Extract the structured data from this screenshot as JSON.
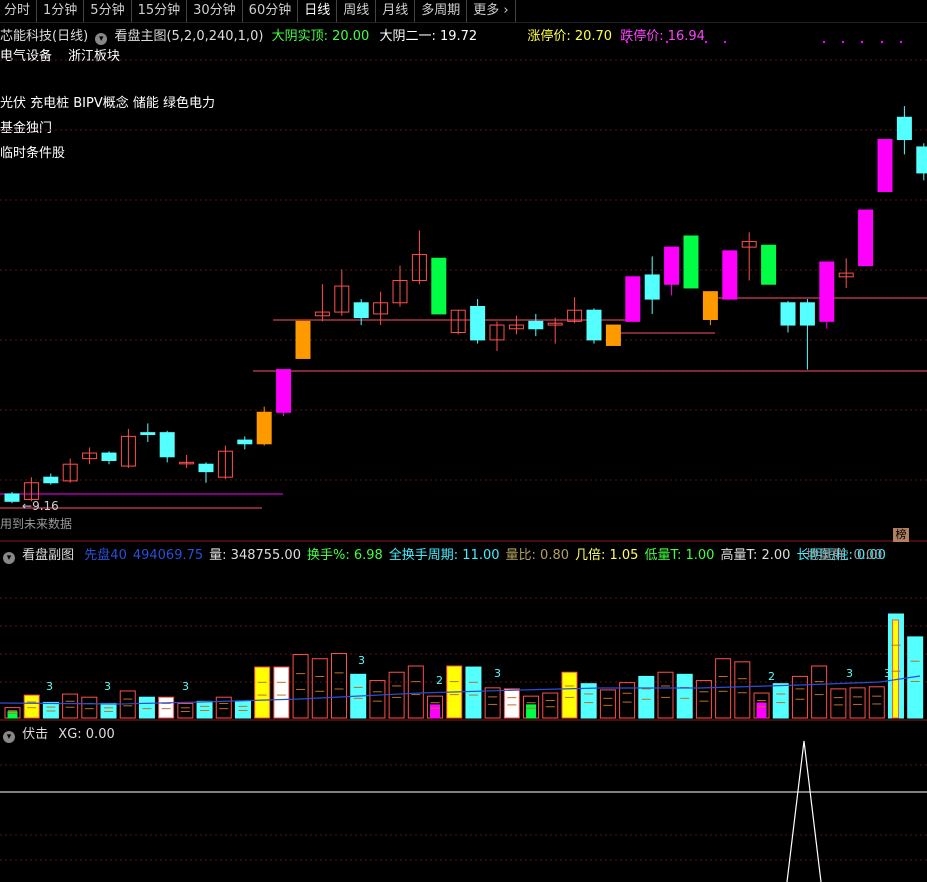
{
  "tabs": [
    "分时",
    "1分钟",
    "5分钟",
    "15分钟",
    "30分钟",
    "60分钟",
    "日线",
    "周线",
    "月线",
    "多周期",
    "更多"
  ],
  "active_tab": "日线",
  "main": {
    "stock": "芯能科技(日线)",
    "indicator": "看盘主图(5,2,0,240,1,0)",
    "yinshi_label": "大阴实顶: 20.00",
    "dayin_label": "大阴二一: 19.72",
    "limit_up": "涨停价: 20.70",
    "limit_down": "跌停价: 16.94",
    "sector1": "电气设备",
    "sector2": "浙江板块",
    "concepts": "光伏 充电桩 BIPV概念 储能 绿色电力",
    "fund": "基金独门",
    "temp": "临时条件股",
    "low_price": "9.16",
    "future_data": "用到未来数据",
    "bang_badge": "榜"
  },
  "sub": {
    "title": "看盘副图",
    "items": [
      {
        "t": "先盘40",
        "c": "#2a4fd6"
      },
      {
        "t": "494069.75",
        "c": "#2a4fd6"
      },
      {
        "t": "量: 348755.00",
        "c": "#dddddd"
      },
      {
        "t": "换手%: 6.98",
        "c": "#44ff44"
      },
      {
        "t": "全换手周期: 11.00",
        "c": "#44eeff"
      },
      {
        "t": "量比: 0.80",
        "c": "#b0a060"
      },
      {
        "t": "几倍: 1.05",
        "c": "#ffff66"
      },
      {
        "t": "低量T: 1.00",
        "c": "#44ff44"
      },
      {
        "t": "高量T: 2.00",
        "c": "#dddddd"
      },
      {
        "t": "长阴短柱: 0.00",
        "c": "#44eeff"
      }
    ],
    "diliang": "地量群: 0.00",
    "vol_tags": [
      "3",
      "3",
      "3",
      "3",
      "2",
      "3",
      "2",
      "3",
      "3"
    ]
  },
  "fuji": {
    "title": "伏击",
    "xg": "XG: 0.00"
  },
  "colors": {
    "up": "#ff4f4f",
    "down": "#54ffff",
    "magenta": "#ff00ff",
    "green": "#00ff44",
    "orange": "#ff9900",
    "grid": "#5a1414"
  },
  "candles": [
    {
      "o": 9.25,
      "c": 9.05,
      "h": 9.3,
      "l": 9.0,
      "k": "down"
    },
    {
      "o": 9.1,
      "c": 9.55,
      "h": 9.7,
      "l": 9.05,
      "k": "up"
    },
    {
      "o": 9.7,
      "c": 9.55,
      "h": 9.8,
      "l": 9.5,
      "k": "down"
    },
    {
      "o": 9.6,
      "c": 10.05,
      "h": 10.2,
      "l": 9.55,
      "k": "up"
    },
    {
      "o": 10.2,
      "c": 10.35,
      "h": 10.5,
      "l": 10.05,
      "k": "up"
    },
    {
      "o": 10.35,
      "c": 10.15,
      "h": 10.4,
      "l": 10.05,
      "k": "down"
    },
    {
      "o": 10.0,
      "c": 10.8,
      "h": 11.0,
      "l": 9.95,
      "k": "up"
    },
    {
      "o": 10.85,
      "c": 10.9,
      "h": 11.15,
      "l": 10.65,
      "k": "down"
    },
    {
      "o": 10.9,
      "c": 10.25,
      "h": 10.95,
      "l": 10.1,
      "k": "down"
    },
    {
      "o": 10.1,
      "c": 10.1,
      "h": 10.3,
      "l": 9.95,
      "k": "up"
    },
    {
      "o": 10.05,
      "c": 9.85,
      "h": 10.1,
      "l": 9.55,
      "k": "down"
    },
    {
      "o": 9.7,
      "c": 10.4,
      "h": 10.55,
      "l": 9.65,
      "k": "up"
    },
    {
      "o": 10.6,
      "c": 10.7,
      "h": 10.8,
      "l": 10.45,
      "k": "down"
    },
    {
      "o": 10.6,
      "c": 11.45,
      "h": 11.6,
      "l": 10.55,
      "k": "orange"
    },
    {
      "o": 11.45,
      "c": 12.6,
      "h": 12.6,
      "l": 11.35,
      "k": "magenta"
    },
    {
      "o": 12.9,
      "c": 13.9,
      "h": 13.9,
      "l": 12.9,
      "k": "orange"
    },
    {
      "o": 14.05,
      "c": 14.15,
      "h": 14.9,
      "l": 13.9,
      "k": "up"
    },
    {
      "o": 14.15,
      "c": 14.85,
      "h": 15.3,
      "l": 14.05,
      "k": "up"
    },
    {
      "o": 14.4,
      "c": 14.0,
      "h": 14.5,
      "l": 13.8,
      "k": "down"
    },
    {
      "o": 14.1,
      "c": 14.4,
      "h": 14.7,
      "l": 13.8,
      "k": "up"
    },
    {
      "o": 14.4,
      "c": 15.0,
      "h": 15.4,
      "l": 14.3,
      "k": "up"
    },
    {
      "o": 15.0,
      "c": 15.7,
      "h": 16.35,
      "l": 14.9,
      "k": "up"
    },
    {
      "o": 14.1,
      "c": 15.6,
      "h": 15.6,
      "l": 14.1,
      "k": "green"
    },
    {
      "o": 13.6,
      "c": 14.2,
      "h": 14.2,
      "l": 13.55,
      "k": "up"
    },
    {
      "o": 14.3,
      "c": 13.4,
      "h": 14.5,
      "l": 13.3,
      "k": "down"
    },
    {
      "o": 13.4,
      "c": 13.8,
      "h": 13.9,
      "l": 13.1,
      "k": "up"
    },
    {
      "o": 13.7,
      "c": 13.8,
      "h": 14.05,
      "l": 13.55,
      "k": "up"
    },
    {
      "o": 13.9,
      "c": 13.7,
      "h": 14.1,
      "l": 13.5,
      "k": "down"
    },
    {
      "o": 13.8,
      "c": 13.85,
      "h": 14.0,
      "l": 13.3,
      "k": "up"
    },
    {
      "o": 13.9,
      "c": 14.2,
      "h": 14.55,
      "l": 13.85,
      "k": "up"
    },
    {
      "o": 14.2,
      "c": 13.4,
      "h": 14.25,
      "l": 13.3,
      "k": "down"
    },
    {
      "o": 13.25,
      "c": 13.8,
      "h": 13.8,
      "l": 13.25,
      "k": "orange"
    },
    {
      "o": 13.9,
      "c": 15.1,
      "h": 15.1,
      "l": 13.9,
      "k": "magenta"
    },
    {
      "o": 15.15,
      "c": 14.5,
      "h": 15.65,
      "l": 14.1,
      "k": "down"
    },
    {
      "o": 14.9,
      "c": 15.9,
      "h": 15.9,
      "l": 14.6,
      "k": "magenta"
    },
    {
      "o": 14.8,
      "c": 16.2,
      "h": 16.2,
      "l": 14.8,
      "k": "green"
    },
    {
      "o": 13.95,
      "c": 14.7,
      "h": 14.7,
      "l": 13.8,
      "k": "orange"
    },
    {
      "o": 14.5,
      "c": 15.8,
      "h": 15.8,
      "l": 14.5,
      "k": "magenta"
    },
    {
      "o": 15.9,
      "c": 16.05,
      "h": 16.3,
      "l": 15.0,
      "k": "up"
    },
    {
      "o": 15.95,
      "c": 14.9,
      "h": 15.95,
      "l": 14.9,
      "k": "green"
    },
    {
      "o": 14.4,
      "c": 13.8,
      "h": 14.45,
      "l": 13.6,
      "k": "down"
    },
    {
      "o": 14.4,
      "c": 13.8,
      "h": 14.5,
      "l": 12.6,
      "k": "down"
    },
    {
      "o": 13.9,
      "c": 15.5,
      "h": 15.5,
      "l": 13.7,
      "k": "magenta"
    },
    {
      "o": 15.1,
      "c": 15.2,
      "h": 15.6,
      "l": 14.8,
      "k": "up"
    },
    {
      "o": 15.4,
      "c": 16.9,
      "h": 16.9,
      "l": 15.4,
      "k": "magenta"
    },
    {
      "o": 17.4,
      "c": 18.8,
      "h": 18.8,
      "l": 17.4,
      "k": "magenta"
    },
    {
      "o": 19.4,
      "c": 18.8,
      "h": 19.7,
      "l": 18.4,
      "k": "down"
    },
    {
      "o": 18.6,
      "c": 17.9,
      "h": 18.7,
      "l": 17.7,
      "k": "down"
    }
  ],
  "volumes": [
    {
      "v": 0.1,
      "k": "green"
    },
    {
      "v": 0.22,
      "k": "yellow"
    },
    {
      "v": 0.15,
      "k": "down"
    },
    {
      "v": 0.23,
      "k": "up"
    },
    {
      "v": 0.2,
      "k": "up"
    },
    {
      "v": 0.14,
      "k": "down"
    },
    {
      "v": 0.26,
      "k": "up"
    },
    {
      "v": 0.2,
      "k": "down"
    },
    {
      "v": 0.2,
      "k": "white"
    },
    {
      "v": 0.14,
      "k": "up"
    },
    {
      "v": 0.16,
      "k": "down"
    },
    {
      "v": 0.2,
      "k": "up"
    },
    {
      "v": 0.16,
      "k": "down"
    },
    {
      "v": 0.49,
      "k": "yellow"
    },
    {
      "v": 0.49,
      "k": "white"
    },
    {
      "v": 0.61,
      "k": "up"
    },
    {
      "v": 0.57,
      "k": "up"
    },
    {
      "v": 0.62,
      "k": "up"
    },
    {
      "v": 0.42,
      "k": "down"
    },
    {
      "v": 0.36,
      "k": "up"
    },
    {
      "v": 0.44,
      "k": "up"
    },
    {
      "v": 0.5,
      "k": "up"
    },
    {
      "v": 0.21,
      "k": "magenta"
    },
    {
      "v": 0.5,
      "k": "yellow"
    },
    {
      "v": 0.49,
      "k": "down"
    },
    {
      "v": 0.29,
      "k": "up"
    },
    {
      "v": 0.28,
      "k": "white"
    },
    {
      "v": 0.21,
      "k": "green"
    },
    {
      "v": 0.24,
      "k": "up"
    },
    {
      "v": 0.44,
      "k": "yellow"
    },
    {
      "v": 0.33,
      "k": "down"
    },
    {
      "v": 0.27,
      "k": "up"
    },
    {
      "v": 0.34,
      "k": "up"
    },
    {
      "v": 0.4,
      "k": "down"
    },
    {
      "v": 0.44,
      "k": "up"
    },
    {
      "v": 0.42,
      "k": "down"
    },
    {
      "v": 0.36,
      "k": "up"
    },
    {
      "v": 0.57,
      "k": "up"
    },
    {
      "v": 0.54,
      "k": "up"
    },
    {
      "v": 0.24,
      "k": "magenta"
    },
    {
      "v": 0.33,
      "k": "down"
    },
    {
      "v": 0.4,
      "k": "up"
    },
    {
      "v": 0.5,
      "k": "up"
    },
    {
      "v": 0.28,
      "k": "up"
    },
    {
      "v": 0.29,
      "k": "up"
    },
    {
      "v": 0.3,
      "k": "up"
    },
    {
      "v": 1.0,
      "k": "yellowbig"
    },
    {
      "v": 0.78,
      "k": "down"
    }
  ]
}
